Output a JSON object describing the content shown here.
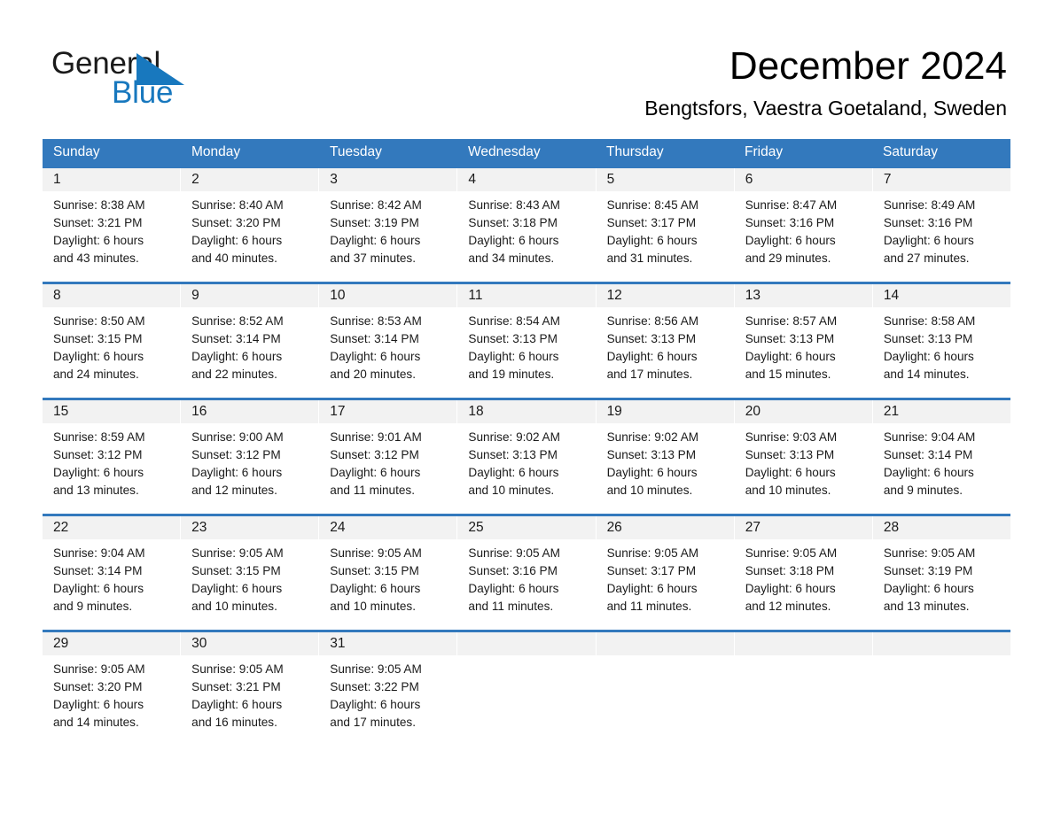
{
  "brand": {
    "name_part1": "General",
    "name_part2": "Blue",
    "triangle_icon": "triangle-logo-icon",
    "accent_color": "#1878be"
  },
  "header": {
    "title": "December 2024",
    "subtitle": "Bengtsfors, Vaestra Goetaland, Sweden"
  },
  "calendar": {
    "header_color": "#3379bd",
    "daynum_band_color": "#f2f2f2",
    "weekdays": [
      "Sunday",
      "Monday",
      "Tuesday",
      "Wednesday",
      "Thursday",
      "Friday",
      "Saturday"
    ],
    "weeks": [
      [
        {
          "day": "1",
          "sunrise": "Sunrise: 8:38 AM",
          "sunset": "Sunset: 3:21 PM",
          "daylight_line1": "Daylight: 6 hours",
          "daylight_line2": "and 43 minutes."
        },
        {
          "day": "2",
          "sunrise": "Sunrise: 8:40 AM",
          "sunset": "Sunset: 3:20 PM",
          "daylight_line1": "Daylight: 6 hours",
          "daylight_line2": "and 40 minutes."
        },
        {
          "day": "3",
          "sunrise": "Sunrise: 8:42 AM",
          "sunset": "Sunset: 3:19 PM",
          "daylight_line1": "Daylight: 6 hours",
          "daylight_line2": "and 37 minutes."
        },
        {
          "day": "4",
          "sunrise": "Sunrise: 8:43 AM",
          "sunset": "Sunset: 3:18 PM",
          "daylight_line1": "Daylight: 6 hours",
          "daylight_line2": "and 34 minutes."
        },
        {
          "day": "5",
          "sunrise": "Sunrise: 8:45 AM",
          "sunset": "Sunset: 3:17 PM",
          "daylight_line1": "Daylight: 6 hours",
          "daylight_line2": "and 31 minutes."
        },
        {
          "day": "6",
          "sunrise": "Sunrise: 8:47 AM",
          "sunset": "Sunset: 3:16 PM",
          "daylight_line1": "Daylight: 6 hours",
          "daylight_line2": "and 29 minutes."
        },
        {
          "day": "7",
          "sunrise": "Sunrise: 8:49 AM",
          "sunset": "Sunset: 3:16 PM",
          "daylight_line1": "Daylight: 6 hours",
          "daylight_line2": "and 27 minutes."
        }
      ],
      [
        {
          "day": "8",
          "sunrise": "Sunrise: 8:50 AM",
          "sunset": "Sunset: 3:15 PM",
          "daylight_line1": "Daylight: 6 hours",
          "daylight_line2": "and 24 minutes."
        },
        {
          "day": "9",
          "sunrise": "Sunrise: 8:52 AM",
          "sunset": "Sunset: 3:14 PM",
          "daylight_line1": "Daylight: 6 hours",
          "daylight_line2": "and 22 minutes."
        },
        {
          "day": "10",
          "sunrise": "Sunrise: 8:53 AM",
          "sunset": "Sunset: 3:14 PM",
          "daylight_line1": "Daylight: 6 hours",
          "daylight_line2": "and 20 minutes."
        },
        {
          "day": "11",
          "sunrise": "Sunrise: 8:54 AM",
          "sunset": "Sunset: 3:13 PM",
          "daylight_line1": "Daylight: 6 hours",
          "daylight_line2": "and 19 minutes."
        },
        {
          "day": "12",
          "sunrise": "Sunrise: 8:56 AM",
          "sunset": "Sunset: 3:13 PM",
          "daylight_line1": "Daylight: 6 hours",
          "daylight_line2": "and 17 minutes."
        },
        {
          "day": "13",
          "sunrise": "Sunrise: 8:57 AM",
          "sunset": "Sunset: 3:13 PM",
          "daylight_line1": "Daylight: 6 hours",
          "daylight_line2": "and 15 minutes."
        },
        {
          "day": "14",
          "sunrise": "Sunrise: 8:58 AM",
          "sunset": "Sunset: 3:13 PM",
          "daylight_line1": "Daylight: 6 hours",
          "daylight_line2": "and 14 minutes."
        }
      ],
      [
        {
          "day": "15",
          "sunrise": "Sunrise: 8:59 AM",
          "sunset": "Sunset: 3:12 PM",
          "daylight_line1": "Daylight: 6 hours",
          "daylight_line2": "and 13 minutes."
        },
        {
          "day": "16",
          "sunrise": "Sunrise: 9:00 AM",
          "sunset": "Sunset: 3:12 PM",
          "daylight_line1": "Daylight: 6 hours",
          "daylight_line2": "and 12 minutes."
        },
        {
          "day": "17",
          "sunrise": "Sunrise: 9:01 AM",
          "sunset": "Sunset: 3:12 PM",
          "daylight_line1": "Daylight: 6 hours",
          "daylight_line2": "and 11 minutes."
        },
        {
          "day": "18",
          "sunrise": "Sunrise: 9:02 AM",
          "sunset": "Sunset: 3:13 PM",
          "daylight_line1": "Daylight: 6 hours",
          "daylight_line2": "and 10 minutes."
        },
        {
          "day": "19",
          "sunrise": "Sunrise: 9:02 AM",
          "sunset": "Sunset: 3:13 PM",
          "daylight_line1": "Daylight: 6 hours",
          "daylight_line2": "and 10 minutes."
        },
        {
          "day": "20",
          "sunrise": "Sunrise: 9:03 AM",
          "sunset": "Sunset: 3:13 PM",
          "daylight_line1": "Daylight: 6 hours",
          "daylight_line2": "and 10 minutes."
        },
        {
          "day": "21",
          "sunrise": "Sunrise: 9:04 AM",
          "sunset": "Sunset: 3:14 PM",
          "daylight_line1": "Daylight: 6 hours",
          "daylight_line2": "and 9 minutes."
        }
      ],
      [
        {
          "day": "22",
          "sunrise": "Sunrise: 9:04 AM",
          "sunset": "Sunset: 3:14 PM",
          "daylight_line1": "Daylight: 6 hours",
          "daylight_line2": "and 9 minutes."
        },
        {
          "day": "23",
          "sunrise": "Sunrise: 9:05 AM",
          "sunset": "Sunset: 3:15 PM",
          "daylight_line1": "Daylight: 6 hours",
          "daylight_line2": "and 10 minutes."
        },
        {
          "day": "24",
          "sunrise": "Sunrise: 9:05 AM",
          "sunset": "Sunset: 3:15 PM",
          "daylight_line1": "Daylight: 6 hours",
          "daylight_line2": "and 10 minutes."
        },
        {
          "day": "25",
          "sunrise": "Sunrise: 9:05 AM",
          "sunset": "Sunset: 3:16 PM",
          "daylight_line1": "Daylight: 6 hours",
          "daylight_line2": "and 11 minutes."
        },
        {
          "day": "26",
          "sunrise": "Sunrise: 9:05 AM",
          "sunset": "Sunset: 3:17 PM",
          "daylight_line1": "Daylight: 6 hours",
          "daylight_line2": "and 11 minutes."
        },
        {
          "day": "27",
          "sunrise": "Sunrise: 9:05 AM",
          "sunset": "Sunset: 3:18 PM",
          "daylight_line1": "Daylight: 6 hours",
          "daylight_line2": "and 12 minutes."
        },
        {
          "day": "28",
          "sunrise": "Sunrise: 9:05 AM",
          "sunset": "Sunset: 3:19 PM",
          "daylight_line1": "Daylight: 6 hours",
          "daylight_line2": "and 13 minutes."
        }
      ],
      [
        {
          "day": "29",
          "sunrise": "Sunrise: 9:05 AM",
          "sunset": "Sunset: 3:20 PM",
          "daylight_line1": "Daylight: 6 hours",
          "daylight_line2": "and 14 minutes."
        },
        {
          "day": "30",
          "sunrise": "Sunrise: 9:05 AM",
          "sunset": "Sunset: 3:21 PM",
          "daylight_line1": "Daylight: 6 hours",
          "daylight_line2": "and 16 minutes."
        },
        {
          "day": "31",
          "sunrise": "Sunrise: 9:05 AM",
          "sunset": "Sunset: 3:22 PM",
          "daylight_line1": "Daylight: 6 hours",
          "daylight_line2": "and 17 minutes."
        },
        {
          "day": "",
          "sunrise": "",
          "sunset": "",
          "daylight_line1": "",
          "daylight_line2": ""
        },
        {
          "day": "",
          "sunrise": "",
          "sunset": "",
          "daylight_line1": "",
          "daylight_line2": ""
        },
        {
          "day": "",
          "sunrise": "",
          "sunset": "",
          "daylight_line1": "",
          "daylight_line2": ""
        },
        {
          "day": "",
          "sunrise": "",
          "sunset": "",
          "daylight_line1": "",
          "daylight_line2": ""
        }
      ]
    ]
  }
}
